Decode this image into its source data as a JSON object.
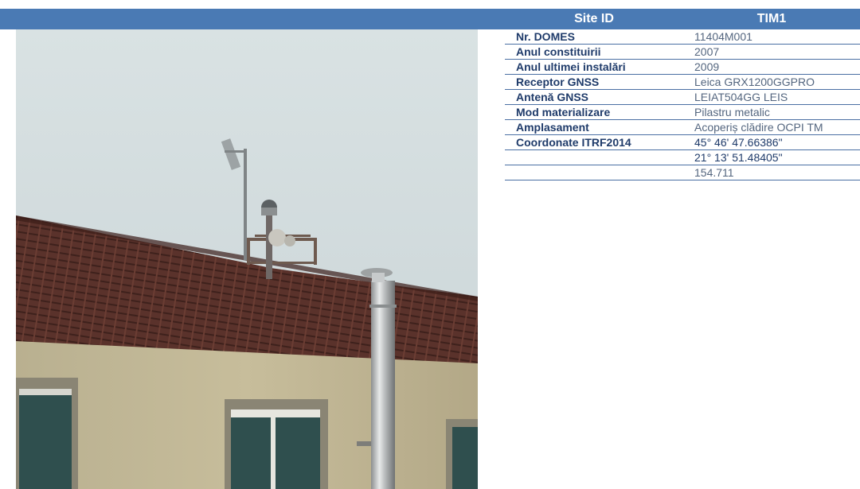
{
  "header": {
    "site_id_label": "Site ID",
    "site_id_value": "TIM1"
  },
  "rows": [
    {
      "label": "Nr. DOMES",
      "value": "11404M001"
    },
    {
      "label": "Anul constituirii",
      "value": "2007"
    },
    {
      "label": "Anul ultimei instalări",
      "value": "2009"
    },
    {
      "label": "Receptor GNSS",
      "value": "Leica GRX1200GGPRO"
    },
    {
      "label": "Antenă GNSS",
      "value": "LEIAT504GG LEIS"
    },
    {
      "label": "Mod materializare",
      "value": "Pilastru metalic"
    },
    {
      "label": "Amplasament",
      "value": "Acoperiș clădire OCPI TM"
    },
    {
      "label": "Coordonate ITRF2014",
      "value": "45° 46' 47.66386\""
    },
    {
      "label": "",
      "value": "21° 13' 51.48405\""
    },
    {
      "label": "",
      "value": "154.711"
    }
  ],
  "colors": {
    "header_blue": "#4a7ab4",
    "label_text": "#1f3b6a",
    "value_text": "#54667f"
  }
}
